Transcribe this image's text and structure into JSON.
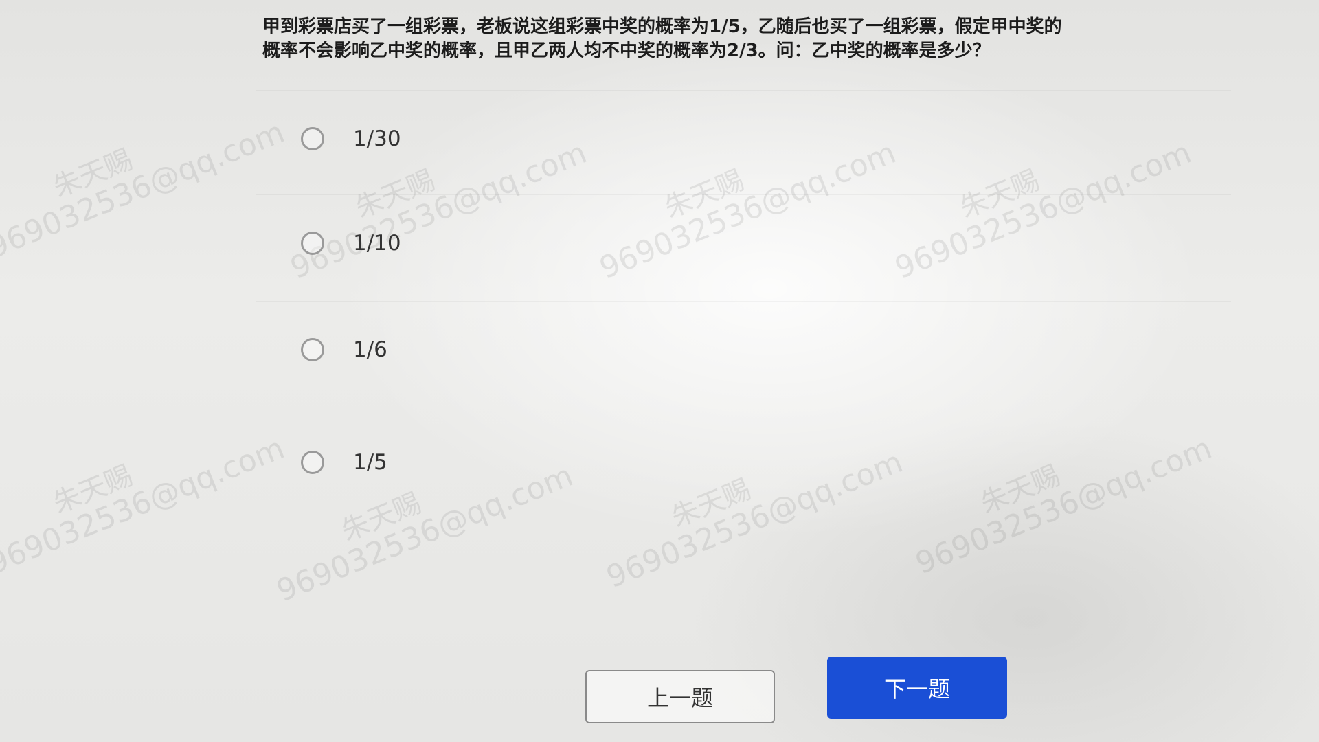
{
  "question": {
    "line1": "甲到彩票店买了一组彩票，老板说这组彩票中奖的概率为1/5，乙随后也买了一组彩票，假定甲中奖的",
    "line2": "概率不会影响乙中奖的概率，且甲乙两人均不中奖的概率为2/3。问：乙中奖的概率是多少？"
  },
  "options": [
    {
      "label": "1/30",
      "selected": false
    },
    {
      "label": "1/10",
      "selected": false
    },
    {
      "label": "1/6",
      "selected": false
    },
    {
      "label": "1/5",
      "selected": false
    }
  ],
  "buttons": {
    "prev_label": "上一题",
    "next_label": "下一题"
  },
  "watermark": {
    "name": "朱天赐",
    "email": "969032536@qq.com"
  },
  "colors": {
    "primary": "#1a4fd6",
    "radio_border": "#9a9a9a"
  }
}
